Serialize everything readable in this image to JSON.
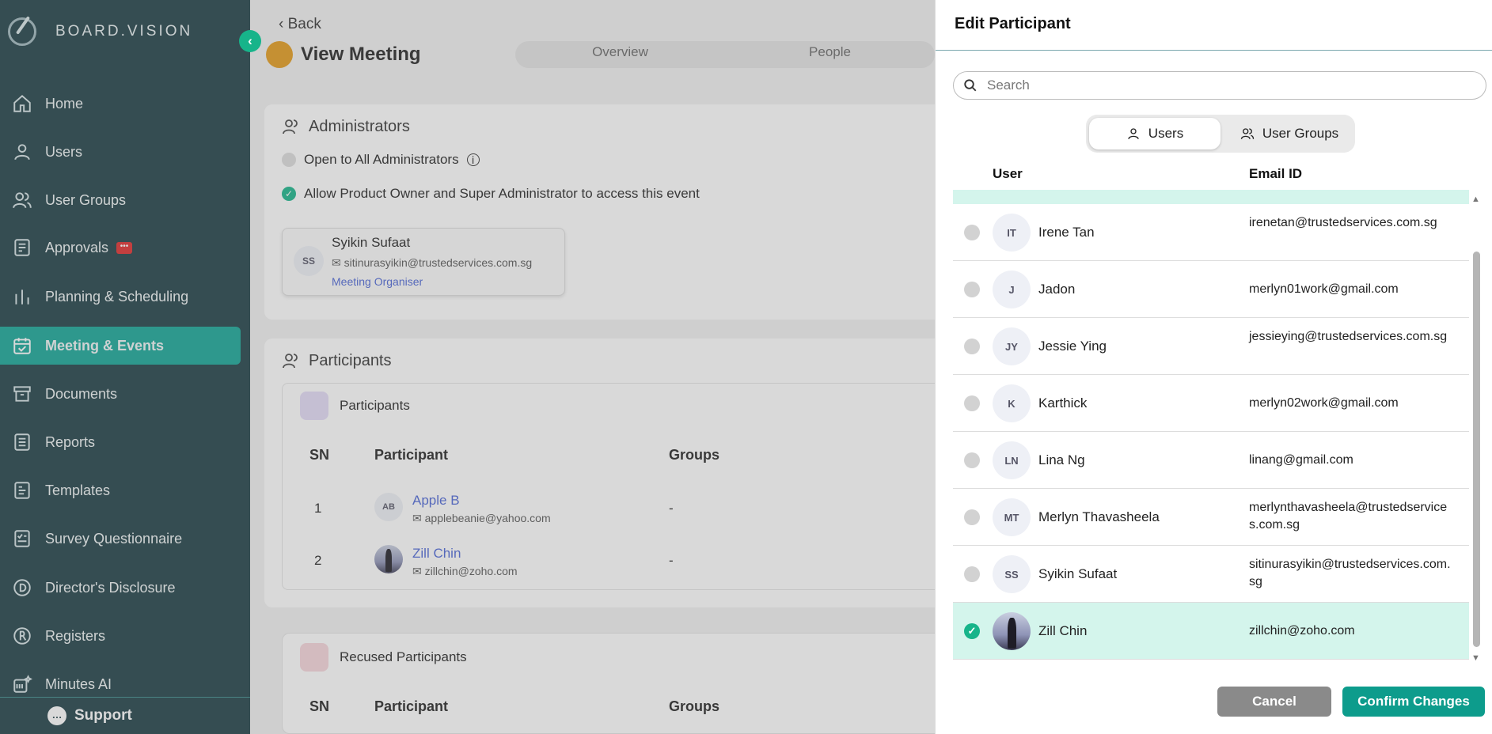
{
  "app": {
    "brand": "BOARD.VISION"
  },
  "sidebar": {
    "items": [
      {
        "label": "Home",
        "icon": "home-icon"
      },
      {
        "label": "Users",
        "icon": "user-icon"
      },
      {
        "label": "User Groups",
        "icon": "users-icon"
      },
      {
        "label": "Approvals",
        "icon": "clipboard-icon",
        "badge": "•••"
      },
      {
        "label": "Planning & Scheduling",
        "icon": "bar-chart-icon"
      },
      {
        "label": "Meeting & Events",
        "icon": "calendar-check-icon",
        "active": true
      },
      {
        "label": "Documents",
        "icon": "archive-icon"
      },
      {
        "label": "Reports",
        "icon": "report-icon"
      },
      {
        "label": "Templates",
        "icon": "template-icon"
      },
      {
        "label": "Survey Questionnaire",
        "icon": "survey-icon"
      },
      {
        "label": "Director's Disclosure",
        "icon": "d-circle-icon"
      },
      {
        "label": "Registers",
        "icon": "r-circle-icon"
      },
      {
        "label": "Minutes AI",
        "icon": "minutes-ai-icon"
      }
    ],
    "support": "Support"
  },
  "main": {
    "back": "Back",
    "title": "View Meeting",
    "tabs": [
      "Overview",
      "People"
    ],
    "administrators": {
      "title": "Administrators",
      "open_all": "Open to All Administrators",
      "allow_owner": "Allow Product Owner and Super Administrator to access this event",
      "organiser": {
        "initials": "SS",
        "name": "Syikin Sufaat",
        "email": "sitinurasyikin@trustedservices.com.sg",
        "role": "Meeting Organiser"
      }
    },
    "participants": {
      "title": "Participants",
      "subtitle": "Participants",
      "columns": [
        "SN",
        "Participant",
        "Groups"
      ],
      "rows": [
        {
          "sn": "1",
          "initials": "AB",
          "name": "Apple B",
          "email": "applebeanie@yahoo.com",
          "groups": "-"
        },
        {
          "sn": "2",
          "initials": "",
          "name": "Zill Chin",
          "email": "zillchin@zoho.com",
          "groups": "-"
        }
      ]
    },
    "recused": {
      "title": "Recused Participants",
      "columns": [
        "SN",
        "Participant",
        "Groups"
      ]
    }
  },
  "panel": {
    "title": "Edit Participant",
    "search_placeholder": "Search",
    "toggle": {
      "users": "Users",
      "groups": "User Groups"
    },
    "columns": {
      "user": "User",
      "email": "Email ID"
    },
    "rows": [
      {
        "initials": "IT",
        "name": "Irene Tan",
        "email": "irenetan@trustedservices.com.sg",
        "selected": false
      },
      {
        "initials": "J",
        "name": "Jadon",
        "email": "merlyn01work@gmail.com",
        "selected": false
      },
      {
        "initials": "JY",
        "name": "Jessie Ying",
        "email": "jessieying@trustedservices.com.sg",
        "selected": false
      },
      {
        "initials": "K",
        "name": "Karthick",
        "email": "merlyn02work@gmail.com",
        "selected": false
      },
      {
        "initials": "LN",
        "name": "Lina Ng",
        "email": "linang@gmail.com",
        "selected": false
      },
      {
        "initials": "MT",
        "name": "Merlyn Thavasheela",
        "email": "merlynthavasheela@trustedservices.com.sg",
        "selected": false
      },
      {
        "initials": "SS",
        "name": "Syikin Sufaat",
        "email": "sitinurasyikin@trustedservices.com.sg",
        "selected": false
      },
      {
        "initials": "",
        "name": "Zill Chin",
        "email": "zillchin@zoho.com",
        "selected": true
      }
    ],
    "cancel": "Cancel",
    "confirm": "Confirm Changes"
  },
  "colors": {
    "sidebar_bg": "#1d3d44",
    "accent": "#12a596",
    "selected_row": "#d4f5ec",
    "check": "#17b48a"
  }
}
